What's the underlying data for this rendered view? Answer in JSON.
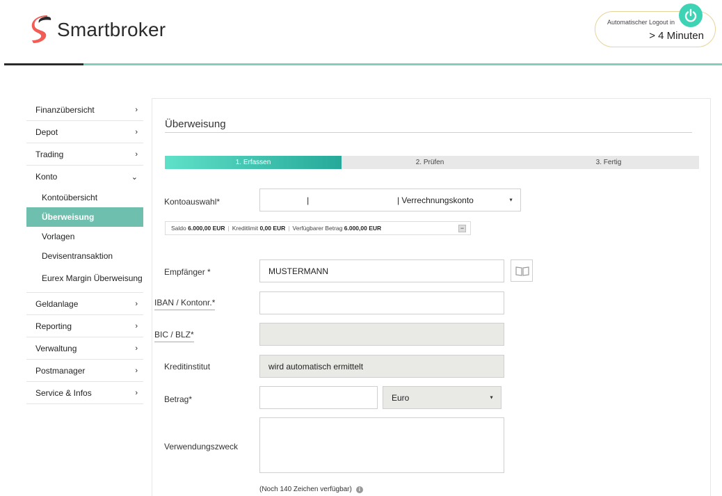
{
  "header": {
    "brand": "Smartbroker",
    "logout_label": "Automatischer Logout in",
    "logout_value": "> 4 Minuten",
    "brand_color": "#f25c54",
    "accent_color": "#3fd3b5"
  },
  "sidebar": {
    "items_top": [
      {
        "label": "Finanzübersicht",
        "chevron": "›"
      },
      {
        "label": "Depot",
        "chevron": "›"
      },
      {
        "label": "Trading",
        "chevron": "›"
      },
      {
        "label": "Konto",
        "chevron": "⌄"
      }
    ],
    "sub_items": [
      {
        "label": "Kontoübersicht"
      },
      {
        "label": "Überweisung",
        "active": true
      },
      {
        "label": "Vorlagen"
      },
      {
        "label": "Devisentransaktion"
      },
      {
        "label": "Eurex Margin Überweisung"
      }
    ],
    "items_bottom": [
      {
        "label": "Geldanlage",
        "chevron": "›"
      },
      {
        "label": "Reporting",
        "chevron": "›"
      },
      {
        "label": "Verwaltung",
        "chevron": "›"
      },
      {
        "label": "Postmanager",
        "chevron": "›"
      },
      {
        "label": "Service & Infos",
        "chevron": "›"
      }
    ]
  },
  "main": {
    "title": "Überweisung",
    "steps": [
      "1. Erfassen",
      "2. Prüfen",
      "3. Fertig"
    ],
    "form": {
      "konto_label": "Kontoauswahl*",
      "konto_value": "|                                      | Verrechnungskonto",
      "saldo_label": "Saldo",
      "saldo_value": "6.000,00",
      "kreditlimit_label": "Kreditlimit",
      "kreditlimit_value": "0,00",
      "verfuegbar_label": "Verfügbarer Betrag",
      "verfuegbar_value": "6.000,00",
      "currency": "EUR",
      "collapse_symbol": "−",
      "empfaenger_label": "Empfänger *",
      "empfaenger_value": "MUSTERMANN",
      "iban_label": "IBAN / Kontonr.*",
      "iban_value": "",
      "bic_label": "BIC / BLZ*",
      "bic_value": "",
      "kreditinstitut_label": "Kreditinstitut",
      "kreditinstitut_value": "wird automatisch ermittelt",
      "betrag_label": "Betrag*",
      "betrag_value": "",
      "waehrung_value": "Euro",
      "zweck_label": "Verwendungszweck",
      "zweck_value": "",
      "counter_text": "(Noch 140 Zeichen verfügbar)",
      "info_symbol": "i",
      "select_arrow": "▼"
    }
  }
}
